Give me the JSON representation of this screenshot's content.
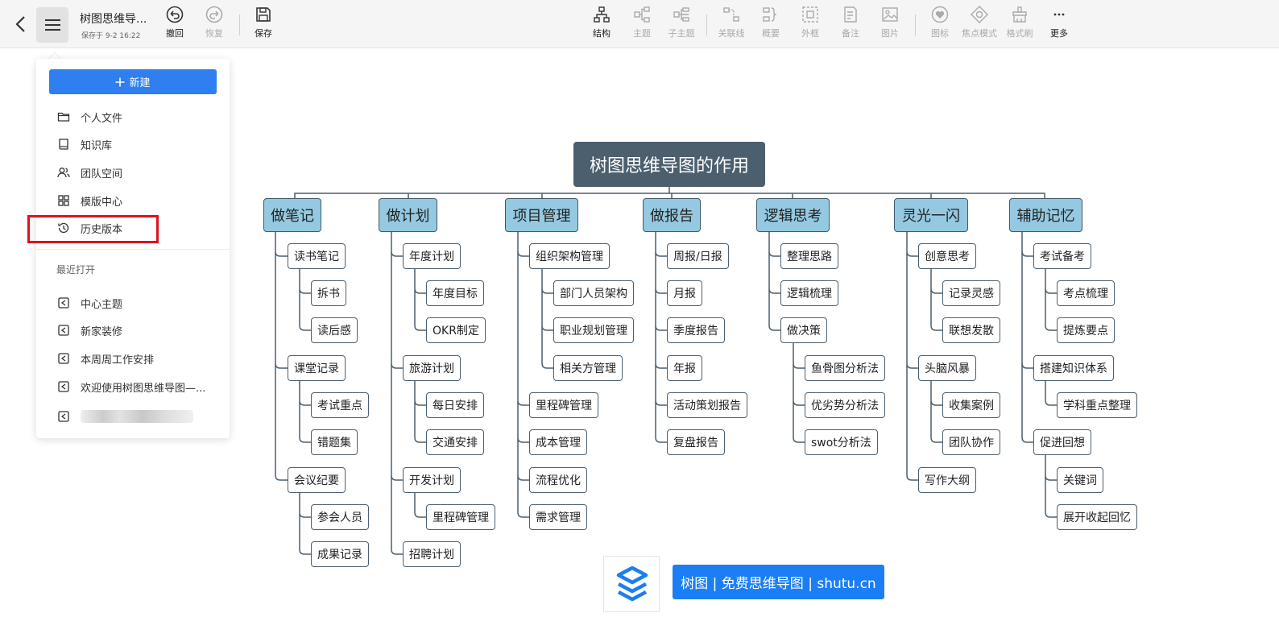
{
  "toolbar": {
    "doc_title": "树图思维导...",
    "saved_status": "保存于 9-2 16:22",
    "undo_label": "撤回",
    "redo_label": "恢复",
    "save_label": "保存",
    "structure_label": "结构",
    "topic_label": "主题",
    "subtopic_label": "子主题",
    "relation_label": "关联线",
    "summary_label": "概要",
    "frame_label": "外框",
    "note_label": "备注",
    "image_label": "图片",
    "icon_label": "图标",
    "focus_label": "焦点模式",
    "format_label": "格式刷",
    "more_label": "更多"
  },
  "menu": {
    "new_label": "新建",
    "items": [
      "个人文件",
      "知识库",
      "团队空间",
      "模版中心",
      "历史版本"
    ],
    "recent_label": "最近打开",
    "recent": [
      "中心主题",
      "新家装修",
      "本周周工作安排",
      "欢迎使用树图思维导图—..."
    ]
  },
  "mindmap": {
    "root": "树图思维导图的作用",
    "branches": [
      {
        "title": "做笔记",
        "nodes": [
          "读书笔记",
          "拆书",
          "读后感",
          "课堂记录",
          "考试重点",
          "错题集",
          "会议纪要",
          "参会人员",
          "成果记录"
        ]
      },
      {
        "title": "做计划",
        "nodes": [
          "年度计划",
          "年度目标",
          "OKR制定",
          "旅游计划",
          "每日安排",
          "交通安排",
          "开发计划",
          "里程碑管理",
          "招聘计划"
        ]
      },
      {
        "title": "项目管理",
        "nodes": [
          "组织架构管理",
          "部门人员架构",
          "职业规划管理",
          "相关方管理",
          "里程碑管理",
          "成本管理",
          "流程优化",
          "需求管理"
        ]
      },
      {
        "title": "做报告",
        "nodes": [
          "周报/日报",
          "月报",
          "季度报告",
          "年报",
          "活动策划报告",
          "复盘报告"
        ]
      },
      {
        "title": "逻辑思考",
        "nodes": [
          "整理思路",
          "逻辑梳理",
          "做决策",
          "鱼骨图分析法",
          "优劣势分析法",
          "swot分析法"
        ]
      },
      {
        "title": "灵光一闪",
        "nodes": [
          "创意思考",
          "记录灵感",
          "联想发散",
          "头脑风暴",
          "收集案例",
          "团队协作",
          "写作大纲"
        ]
      },
      {
        "title": "辅助记忆",
        "nodes": [
          "考试备考",
          "考点梳理",
          "提炼要点",
          "搭建知识体系",
          "学科重点整理",
          "促进回想",
          "关键词",
          "展开收起回忆"
        ]
      }
    ]
  },
  "watermark": {
    "text": "树图 | 免费思维导图 | shutu.cn"
  },
  "colors": {
    "root_bg": "#4c5f6f",
    "branch_bg": "#95c9e2",
    "accent_blue": "#2f7ff0",
    "highlight_red": "#e0101a"
  }
}
